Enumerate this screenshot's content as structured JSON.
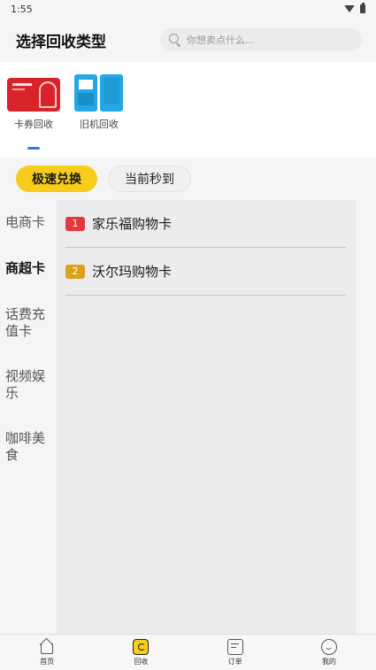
{
  "status_bar": {
    "time": "1:55",
    "icons": [
      "wifi-icon",
      "battery-icon"
    ]
  },
  "header": {
    "title": "选择回收类型",
    "search_placeholder": "你想卖点什么..."
  },
  "categories": [
    {
      "label": "卡券回收",
      "icon": "gift-card-thumbnail",
      "selected": true
    },
    {
      "label": "旧机回收",
      "icon": "phone-thumbnail",
      "selected": false
    }
  ],
  "exchange_tabs": [
    {
      "label": "极速兑换",
      "active": true
    },
    {
      "label": "当前秒到",
      "active": false
    }
  ],
  "sidebar": {
    "items": [
      {
        "label": "电商卡",
        "active": false
      },
      {
        "label": "商超卡",
        "active": true
      },
      {
        "label": "话费充值卡",
        "active": false
      },
      {
        "label": "视频娱乐",
        "active": false
      },
      {
        "label": "咖啡美食",
        "active": false
      }
    ]
  },
  "card_list": [
    {
      "rank": "1",
      "name": "家乐福购物卡",
      "badge_color": "#e0393e"
    },
    {
      "rank": "2",
      "name": "沃尔玛购物卡",
      "badge_color": "#d9a21b"
    }
  ],
  "tabbar": [
    {
      "label": "首页",
      "icon": "home-icon"
    },
    {
      "label": "回收",
      "icon": "recycle-icon",
      "active": true
    },
    {
      "label": "订单",
      "icon": "order-icon"
    },
    {
      "label": "我的",
      "icon": "profile-icon"
    }
  ],
  "colors": {
    "accent": "#f8cc1b",
    "indicator": "#2c7be5"
  }
}
